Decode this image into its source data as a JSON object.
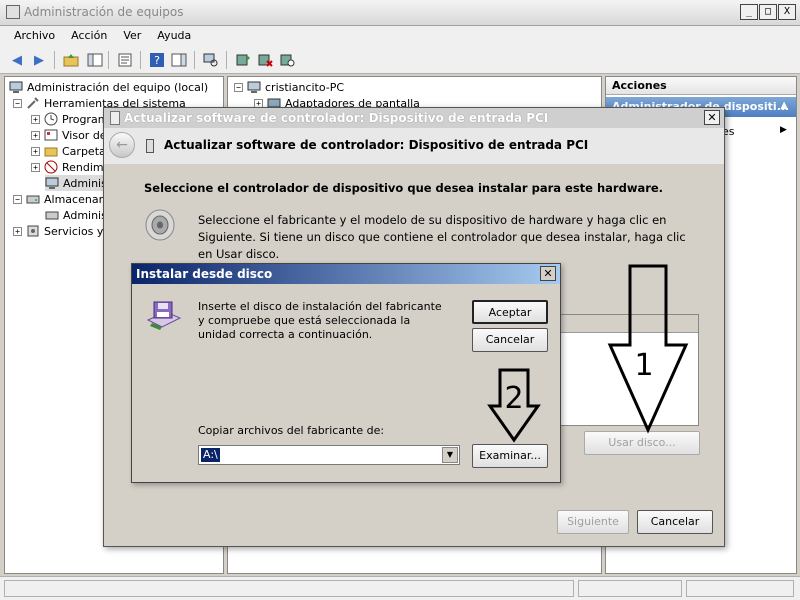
{
  "window": {
    "title": "Administración de equipos",
    "controls": [
      "_",
      "□",
      "X"
    ]
  },
  "menubar": [
    "Archivo",
    "Acción",
    "Ver",
    "Ayuda"
  ],
  "tree": [
    {
      "label": "Administración del equipo (local)"
    },
    {
      "label": "Herramientas del sistema"
    },
    {
      "label": "Program"
    },
    {
      "label": "Visor de"
    },
    {
      "label": "Carpeta"
    },
    {
      "label": "Rendim"
    },
    {
      "label": "Adminis"
    },
    {
      "label": "Almacenam"
    },
    {
      "label": "Adminis"
    },
    {
      "label": "Servicios y"
    }
  ],
  "middle_tree": [
    {
      "label": "cristiancito-PC"
    },
    {
      "label": "Adaptadores de pantalla"
    }
  ],
  "actions": {
    "header": "Acciones",
    "selected": "Administrador de dispositi...",
    "more": "es"
  },
  "wizard": {
    "title": "Actualizar software de controlador: Dispositivo de entrada PCI",
    "header_title": "Actualizar software de controlador: Dispositivo de entrada PCI",
    "heading": "Seleccione el controlador de dispositivo que desea instalar para este hardware.",
    "description": "Seleccione el fabricante y el modelo de su dispositivo de hardware y haga clic en Siguiente. Si tiene un disco que contiene el controlador que desea instalar, haga clic en  Usar disco.",
    "have_disk_button": "Usar disco...",
    "next_button": "Siguiente",
    "cancel_button": "Cancelar"
  },
  "install_dialog": {
    "title": "Instalar desde disco",
    "message": "Inserte el disco de instalación del fabricante y compruebe que está seleccionada la unidad correcta a continuación.",
    "ok_button": "Aceptar",
    "cancel_button": "Cancelar",
    "copy_label": "Copiar archivos del fabricante de:",
    "copy_value": "A:\\",
    "browse_button": "Examinar..."
  },
  "annotations": [
    "1",
    "2"
  ]
}
